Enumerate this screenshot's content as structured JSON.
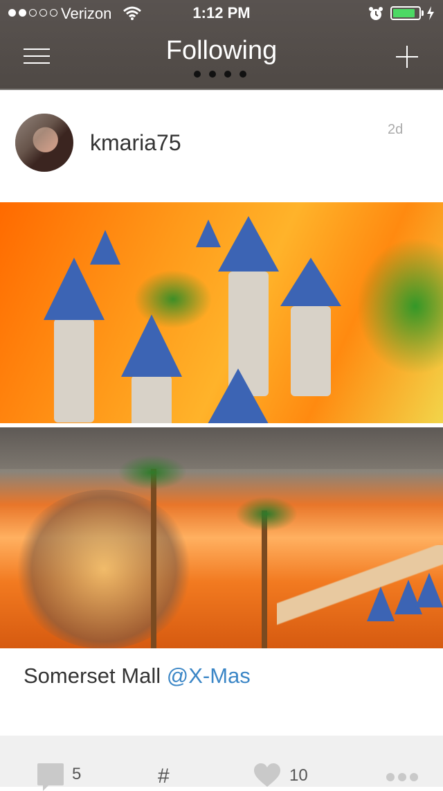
{
  "status_bar": {
    "carrier": "Verizon",
    "time": "1:12 PM",
    "signal_bars_filled": 2,
    "signal_bars_total": 5,
    "battery_level": 0.85,
    "battery_color": "#4cd964"
  },
  "header": {
    "title": "Following",
    "page_dots": 4,
    "background": "#524c49"
  },
  "post": {
    "username": "kmaria75",
    "age": "2d",
    "caption": "Somerset Mall",
    "caption_tag": "@X-Mas",
    "photos": [
      "photo",
      "photo"
    ]
  },
  "actions": {
    "comments_count": "5",
    "hash_label": "#",
    "likes_count": "10"
  },
  "icons": {
    "menu": "menu-icon",
    "add": "plus-icon",
    "comment": "comment-icon",
    "like": "heart-icon",
    "more": "more-icon"
  }
}
